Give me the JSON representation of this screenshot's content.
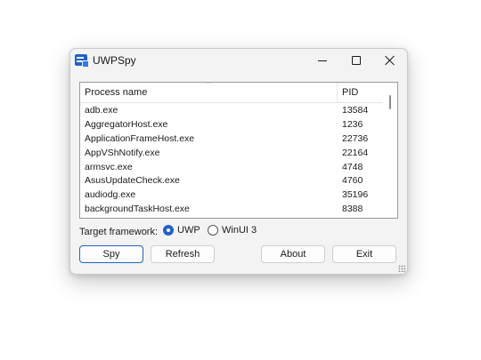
{
  "window": {
    "title": "UWPSpy",
    "accent_color": "#1f62c9"
  },
  "list": {
    "columns": {
      "name": "Process name",
      "pid": "PID"
    },
    "rows": [
      {
        "name": "adb.exe",
        "pid": "13584"
      },
      {
        "name": "AggregatorHost.exe",
        "pid": "1236"
      },
      {
        "name": "ApplicationFrameHost.exe",
        "pid": "22736"
      },
      {
        "name": "AppVShNotify.exe",
        "pid": "22164"
      },
      {
        "name": "armsvc.exe",
        "pid": "4748"
      },
      {
        "name": "AsusUpdateCheck.exe",
        "pid": "4760"
      },
      {
        "name": "audiodg.exe",
        "pid": "35196"
      },
      {
        "name": "backgroundTaskHost.exe",
        "pid": "8388"
      }
    ]
  },
  "framework": {
    "label": "Target framework:",
    "options": [
      {
        "label": "UWP",
        "selected": true
      },
      {
        "label": "WinUI 3",
        "selected": false
      }
    ]
  },
  "buttons": {
    "spy": "Spy",
    "refresh": "Refresh",
    "about": "About",
    "exit": "Exit"
  },
  "icons": {
    "app": "uwpspy-app-icon",
    "minimize": "minimize-icon",
    "maximize": "maximize-icon",
    "close": "close-icon",
    "sort": "sort-ascending-icon"
  }
}
